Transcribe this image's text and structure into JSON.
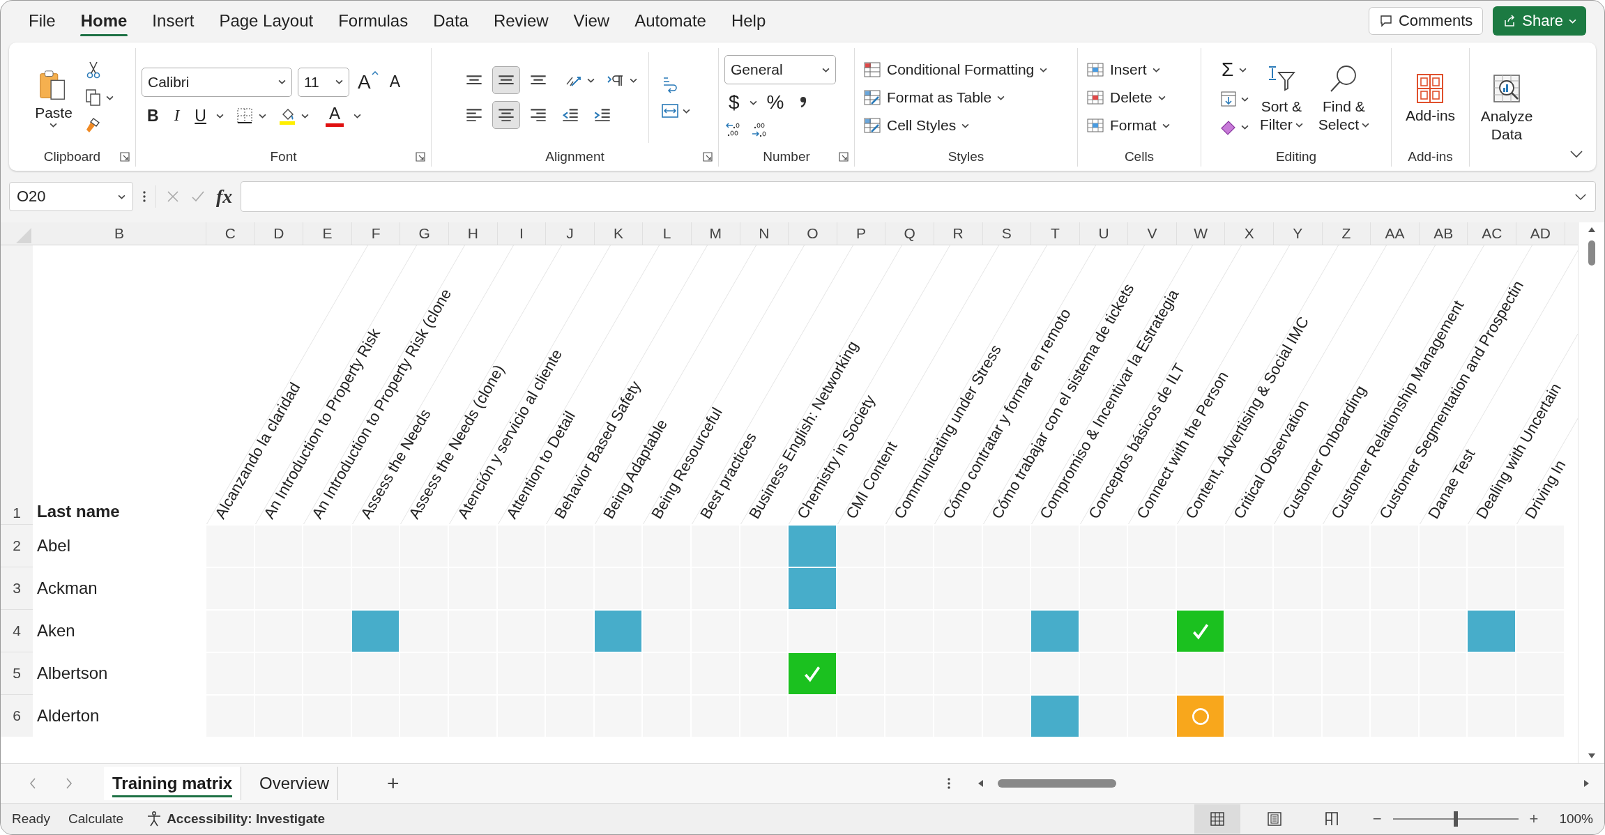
{
  "menu": {
    "tabs": [
      {
        "label": "File",
        "selected": false
      },
      {
        "label": "Home",
        "selected": true
      },
      {
        "label": "Insert",
        "selected": false
      },
      {
        "label": "Page Layout",
        "selected": false
      },
      {
        "label": "Formulas",
        "selected": false
      },
      {
        "label": "Data",
        "selected": false
      },
      {
        "label": "Review",
        "selected": false
      },
      {
        "label": "View",
        "selected": false
      },
      {
        "label": "Automate",
        "selected": false
      },
      {
        "label": "Help",
        "selected": false
      }
    ],
    "comments": "Comments",
    "share": "Share"
  },
  "ribbon": {
    "clipboard": {
      "paste": "Paste",
      "label": "Clipboard"
    },
    "font": {
      "name": "Calibri",
      "size": "11",
      "grow": "A",
      "shrink": "A",
      "bold": "B",
      "italic": "I",
      "underline": "U",
      "font_color_letter": "A",
      "label": "Font"
    },
    "alignment": {
      "buttons": [
        {
          "kind": "top",
          "selected": false
        },
        {
          "kind": "middle",
          "selected": true
        },
        {
          "kind": "bottom",
          "selected": false
        },
        {
          "kind": "left",
          "selected": false
        },
        {
          "kind": "center",
          "selected": true
        },
        {
          "kind": "right",
          "selected": false
        },
        {
          "kind": "outdent",
          "selected": false
        },
        {
          "kind": "indent",
          "selected": false
        }
      ],
      "label": "Alignment"
    },
    "number": {
      "format": "General",
      "currency": "$",
      "percent": "%",
      "label": "Number"
    },
    "styles": {
      "items": [
        "Conditional Formatting",
        "Format as Table",
        "Cell Styles"
      ],
      "label": "Styles"
    },
    "cells": {
      "items": [
        "Insert",
        "Delete",
        "Format"
      ],
      "label": "Cells"
    },
    "editing": {
      "sum": "Σ",
      "sort": [
        "Sort &",
        "Filter"
      ],
      "find": [
        "Find &",
        "Select"
      ],
      "label": "Editing"
    },
    "addins": {
      "button": "Add-ins",
      "label": "Add-ins"
    },
    "analyze": {
      "button": [
        "Analyze",
        "Data"
      ]
    }
  },
  "formula_bar": {
    "name_box": "O20",
    "fx": "fx"
  },
  "sheet": {
    "columns": [
      "B",
      "C",
      "D",
      "E",
      "F",
      "G",
      "H",
      "I",
      "J",
      "K",
      "L",
      "M",
      "N",
      "O",
      "P",
      "Q",
      "R",
      "S",
      "T",
      "U",
      "V",
      "W",
      "X",
      "Y",
      "Z",
      "AA",
      "AB",
      "AC",
      "AD"
    ],
    "header_row": {
      "number": "1",
      "label": "Last name",
      "courses": [
        "Alcanzando la claridad",
        "An Introduction to Property Risk",
        "An Introduction to Property Risk (clone",
        "Assess the Needs",
        "Assess the Needs (clone)",
        "Atención y servicio al cliente",
        "Attention to Detail",
        "Behavior Based Safety",
        "Being Adaptable",
        "Being Resourceful",
        "Best practices",
        "Business English: Networking",
        "Chemistry in Society",
        "CMI Content",
        "Communicating under Stress",
        "Cómo contratar y formar en remoto",
        "Cómo trabajar con el sistema de tickets",
        "Compromiso & Incentivar la Estrategia",
        "Conceptos básicos de ILT",
        "Connect with the Person",
        "Content, Advertising & Social IMC",
        "Critical Observation",
        "Customer Onboarding",
        "Customer Relationship Management",
        "Customer Segmentation and Prospectin",
        "Danae Test",
        "Dealing with Uncertain",
        "Driving In"
      ]
    },
    "rows": [
      {
        "number": "2",
        "name": "Abel",
        "cells": [
          {
            "kind": "empty"
          },
          {
            "kind": "empty"
          },
          {
            "kind": "empty"
          },
          {
            "kind": "empty"
          },
          {
            "kind": "empty"
          },
          {
            "kind": "empty"
          },
          {
            "kind": "empty"
          },
          {
            "kind": "empty"
          },
          {
            "kind": "empty"
          },
          {
            "kind": "empty"
          },
          {
            "kind": "empty"
          },
          {
            "kind": "empty"
          },
          {
            "kind": "assigned"
          },
          {
            "kind": "empty"
          },
          {
            "kind": "empty"
          },
          {
            "kind": "empty"
          },
          {
            "kind": "empty"
          },
          {
            "kind": "empty"
          },
          {
            "kind": "empty"
          },
          {
            "kind": "empty"
          },
          {
            "kind": "empty"
          },
          {
            "kind": "empty"
          },
          {
            "kind": "empty"
          },
          {
            "kind": "empty"
          },
          {
            "kind": "empty"
          },
          {
            "kind": "empty"
          },
          {
            "kind": "empty"
          },
          {
            "kind": "empty"
          }
        ]
      },
      {
        "number": "3",
        "name": "Ackman",
        "cells": [
          {
            "kind": "empty"
          },
          {
            "kind": "empty"
          },
          {
            "kind": "empty"
          },
          {
            "kind": "empty"
          },
          {
            "kind": "empty"
          },
          {
            "kind": "empty"
          },
          {
            "kind": "empty"
          },
          {
            "kind": "empty"
          },
          {
            "kind": "empty"
          },
          {
            "kind": "empty"
          },
          {
            "kind": "empty"
          },
          {
            "kind": "empty"
          },
          {
            "kind": "assigned"
          },
          {
            "kind": "empty"
          },
          {
            "kind": "empty"
          },
          {
            "kind": "empty"
          },
          {
            "kind": "empty"
          },
          {
            "kind": "empty"
          },
          {
            "kind": "empty"
          },
          {
            "kind": "empty"
          },
          {
            "kind": "empty"
          },
          {
            "kind": "empty"
          },
          {
            "kind": "empty"
          },
          {
            "kind": "empty"
          },
          {
            "kind": "empty"
          },
          {
            "kind": "empty"
          },
          {
            "kind": "empty"
          },
          {
            "kind": "empty"
          }
        ]
      },
      {
        "number": "4",
        "name": "Aken",
        "cells": [
          {
            "kind": "empty"
          },
          {
            "kind": "empty"
          },
          {
            "kind": "empty"
          },
          {
            "kind": "assigned"
          },
          {
            "kind": "empty"
          },
          {
            "kind": "empty"
          },
          {
            "kind": "empty"
          },
          {
            "kind": "empty"
          },
          {
            "kind": "assigned"
          },
          {
            "kind": "empty"
          },
          {
            "kind": "empty"
          },
          {
            "kind": "empty"
          },
          {
            "kind": "empty"
          },
          {
            "kind": "empty"
          },
          {
            "kind": "empty"
          },
          {
            "kind": "empty"
          },
          {
            "kind": "empty"
          },
          {
            "kind": "assigned"
          },
          {
            "kind": "empty"
          },
          {
            "kind": "empty"
          },
          {
            "kind": "completed"
          },
          {
            "kind": "empty"
          },
          {
            "kind": "empty"
          },
          {
            "kind": "empty"
          },
          {
            "kind": "empty"
          },
          {
            "kind": "empty"
          },
          {
            "kind": "assigned"
          },
          {
            "kind": "empty"
          }
        ]
      },
      {
        "number": "5",
        "name": "Albertson",
        "cells": [
          {
            "kind": "empty"
          },
          {
            "kind": "empty"
          },
          {
            "kind": "empty"
          },
          {
            "kind": "empty"
          },
          {
            "kind": "empty"
          },
          {
            "kind": "empty"
          },
          {
            "kind": "empty"
          },
          {
            "kind": "empty"
          },
          {
            "kind": "empty"
          },
          {
            "kind": "empty"
          },
          {
            "kind": "empty"
          },
          {
            "kind": "empty"
          },
          {
            "kind": "completed"
          },
          {
            "kind": "empty"
          },
          {
            "kind": "empty"
          },
          {
            "kind": "empty"
          },
          {
            "kind": "empty"
          },
          {
            "kind": "empty"
          },
          {
            "kind": "empty"
          },
          {
            "kind": "empty"
          },
          {
            "kind": "empty"
          },
          {
            "kind": "empty"
          },
          {
            "kind": "empty"
          },
          {
            "kind": "empty"
          },
          {
            "kind": "empty"
          },
          {
            "kind": "empty"
          },
          {
            "kind": "empty"
          },
          {
            "kind": "empty"
          }
        ]
      },
      {
        "number": "6",
        "name": "Alderton",
        "cells": [
          {
            "kind": "empty"
          },
          {
            "kind": "empty"
          },
          {
            "kind": "empty"
          },
          {
            "kind": "empty"
          },
          {
            "kind": "empty"
          },
          {
            "kind": "empty"
          },
          {
            "kind": "empty"
          },
          {
            "kind": "empty"
          },
          {
            "kind": "empty"
          },
          {
            "kind": "empty"
          },
          {
            "kind": "empty"
          },
          {
            "kind": "empty"
          },
          {
            "kind": "empty"
          },
          {
            "kind": "empty"
          },
          {
            "kind": "empty"
          },
          {
            "kind": "empty"
          },
          {
            "kind": "empty"
          },
          {
            "kind": "assigned"
          },
          {
            "kind": "empty"
          },
          {
            "kind": "empty"
          },
          {
            "kind": "pending"
          },
          {
            "kind": "empty"
          },
          {
            "kind": "empty"
          },
          {
            "kind": "empty"
          },
          {
            "kind": "empty"
          },
          {
            "kind": "empty"
          },
          {
            "kind": "empty"
          },
          {
            "kind": "empty"
          }
        ]
      }
    ]
  },
  "sheet_tabs": {
    "tabs": [
      {
        "label": "Training matrix",
        "selected": true
      },
      {
        "label": "Overview",
        "selected": false
      }
    ],
    "add": "+"
  },
  "status_bar": {
    "ready": "Ready",
    "calculate": "Calculate",
    "accessibility": "Accessibility: Investigate",
    "views": [
      {
        "kind": "normal",
        "selected": true
      },
      {
        "kind": "page_layout",
        "selected": false
      },
      {
        "kind": "page_break",
        "selected": false
      }
    ],
    "zoom": {
      "minus": "−",
      "plus": "+",
      "level": 0.5,
      "reading": "100%"
    }
  }
}
